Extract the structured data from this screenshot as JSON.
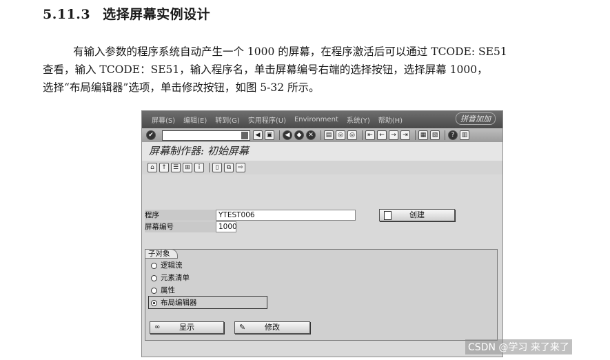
{
  "heading": {
    "number": "5.11.3",
    "title": "选择屏幕实例设计"
  },
  "paragraph": {
    "line1": "有输入参数的程序系统自动产生一个 1000 的屏幕，在程序激活后可以通过 TCODE: SE51",
    "line2": "查看，输入 TCODE：SE51，输入程序名，单击屏幕编号右端的选择按钮，选择屏幕 1000，",
    "line3": "选择“布局编辑器”选项，单击修改按钮，如图 5-32 所示。"
  },
  "sap": {
    "menu": [
      "屏幕(S)",
      "编辑(E)",
      "转到(G)",
      "实用程序(U)",
      "Environment",
      "系统(Y)",
      "帮助(H)"
    ],
    "logo_text": "拼音加加",
    "title": "屏幕制作器: 初始屏幕",
    "program_label": "程序",
    "program_value": "YTEST006",
    "screen_label": "屏幕编号",
    "screen_value": "1000",
    "create_button": "创建",
    "subobjects_label": "子对象",
    "radio": [
      {
        "label": "逻辑流",
        "selected": false
      },
      {
        "label": "元素清单",
        "selected": false
      },
      {
        "label": "属性",
        "selected": false
      },
      {
        "label": "布局编辑器",
        "selected": true
      }
    ],
    "show_button": "显示",
    "change_button": "修改"
  },
  "watermark": "CSDN @学习 来了来了"
}
